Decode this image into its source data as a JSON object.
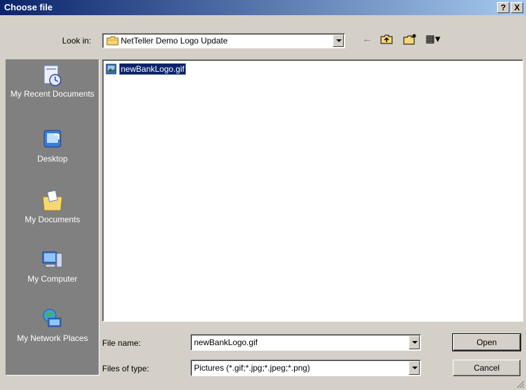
{
  "window": {
    "title": "Choose file",
    "help_label": "?",
    "close_label": "X"
  },
  "toolbar": {
    "lookin_label": "Look in:",
    "lookin_value": "NetTeller Demo Logo Update",
    "back_glyph": "←",
    "up_glyph": "↑",
    "newfolder_glyph": "✦",
    "views_glyph": "▦▾"
  },
  "places": [
    {
      "label": "My Recent Documents",
      "icon": "recent-documents-icon"
    },
    {
      "label": "Desktop",
      "icon": "desktop-icon"
    },
    {
      "label": "My Documents",
      "icon": "my-documents-icon"
    },
    {
      "label": "My Computer",
      "icon": "my-computer-icon"
    },
    {
      "label": "My Network Places",
      "icon": "network-places-icon"
    }
  ],
  "files": [
    {
      "name": "newBankLogo.gif",
      "icon": "gif-file-icon",
      "selected": true
    }
  ],
  "form": {
    "filename_label": "File name:",
    "filename_value": "newBankLogo.gif",
    "filetype_label": "Files of type:",
    "filetype_value": "Pictures (*.gif;*.jpg;*.jpeg;*.png)"
  },
  "buttons": {
    "open_label": "Open",
    "cancel_label": "Cancel"
  },
  "colors": {
    "titlebar": "#0a246a",
    "selection": "#0a246a",
    "places_bg": "#808080",
    "dialog_bg": "#d4d0c8"
  }
}
